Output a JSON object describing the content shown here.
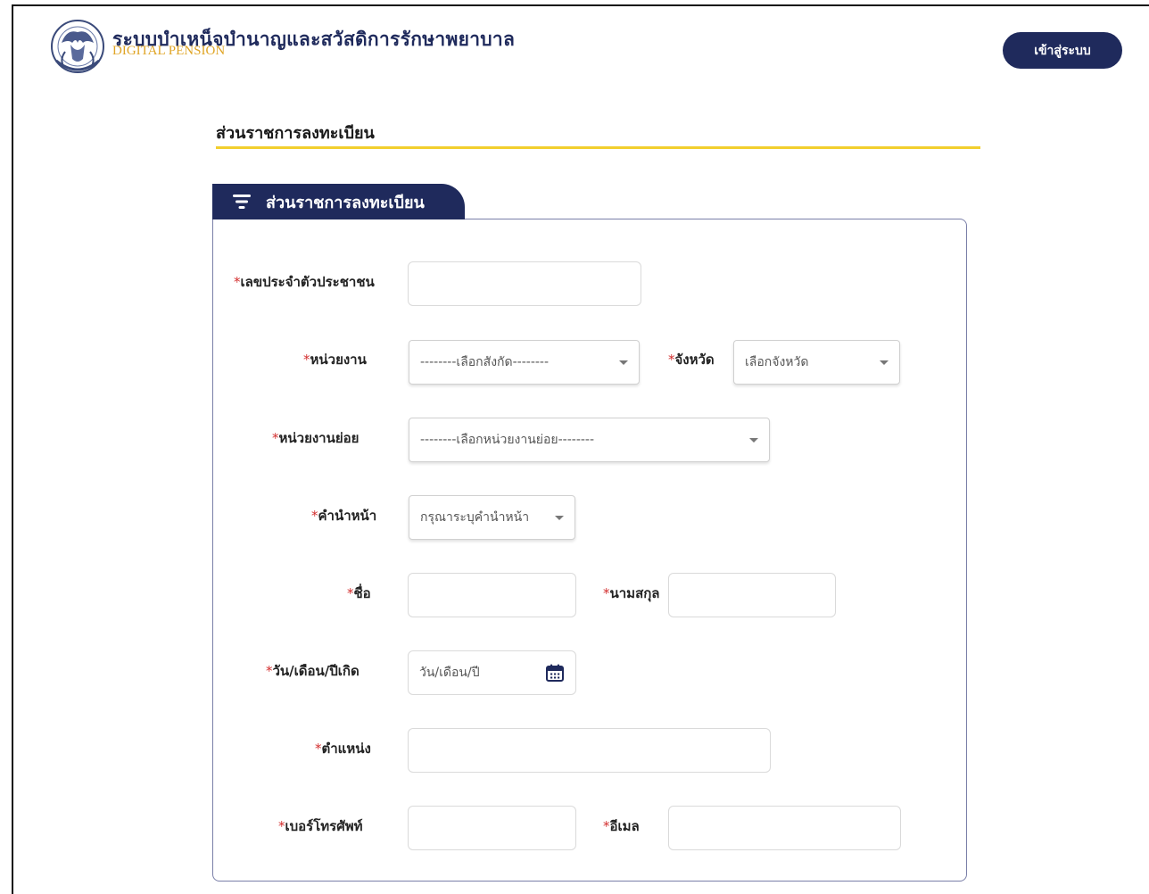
{
  "header": {
    "logo_icon": "department-emblem-icon",
    "title": "ระบบบำเหน็จบำนาญและสวัสดิการรักษาพยาบาล",
    "subtitle": "DIGITAL PENSION",
    "login_label": "เข้าสู่ระบบ"
  },
  "page": {
    "heading": "ส่วนราชการลงทะเบียน"
  },
  "card": {
    "tab_label": "ส่วนราชการลงทะเบียน",
    "tab_icon": "filter-icon"
  },
  "form": {
    "required_mark": "*",
    "citizen_id": {
      "label": "เลขประจำตัวประชาชน",
      "value": ""
    },
    "agency": {
      "label": "หน่วยงาน",
      "selected": "--------เลือกสังกัด--------"
    },
    "province": {
      "label": "จังหวัด",
      "selected": "เลือกจังหวัด"
    },
    "sub_agency": {
      "label": "หน่วยงานย่อย",
      "selected": "--------เลือกหน่วยงานย่อย--------"
    },
    "prefix": {
      "label": "คำนำหน้า",
      "selected": "กรุณาระบุคำนำหน้า"
    },
    "first_name": {
      "label": "ชื่อ",
      "value": ""
    },
    "last_name": {
      "label": "นามสกุล",
      "value": ""
    },
    "birth_date": {
      "label": "วัน/เดือน/ปีเกิด",
      "placeholder": "วัน/เดือน/ปี",
      "icon": "calendar-icon"
    },
    "position": {
      "label": "ตำแหน่ง",
      "value": ""
    },
    "phone": {
      "label": "เบอร์โทรศัพท์",
      "value": ""
    },
    "email": {
      "label": "อีเมล",
      "value": ""
    }
  },
  "colors": {
    "brand_navy": "#1f2a5c",
    "accent_yellow": "#f2cf2e",
    "subtitle_gold": "#e0a526",
    "required_red": "#d32f2f"
  }
}
